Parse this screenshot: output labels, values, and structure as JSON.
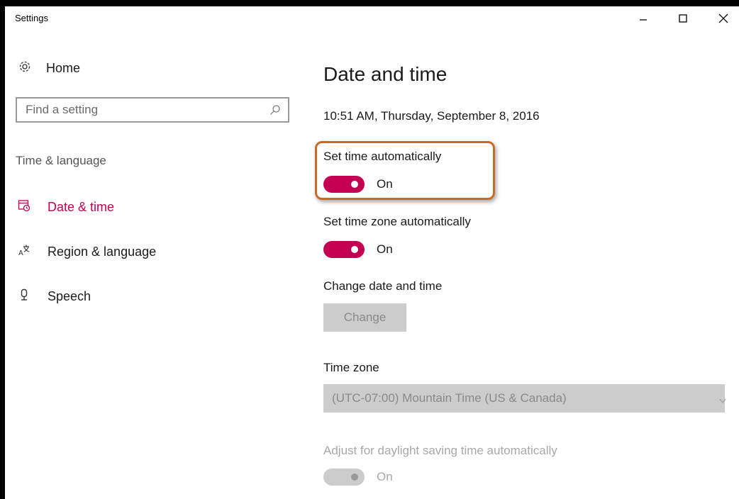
{
  "window": {
    "title": "Settings",
    "controls": [
      "minimize-icon",
      "maximize-icon",
      "close-icon"
    ]
  },
  "sidebar": {
    "home_label": "Home",
    "search_placeholder": "Find a setting",
    "section_label": "Time & language",
    "items": [
      {
        "label": "Date & time",
        "icon": "calendar-clock-icon",
        "active": true
      },
      {
        "label": "Region & language",
        "icon": "region-language-icon",
        "active": false
      },
      {
        "label": "Speech",
        "icon": "microphone-icon",
        "active": false
      }
    ]
  },
  "main": {
    "title": "Date and time",
    "current_time": "10:51 AM, Thursday, September 8, 2016",
    "set_time_auto": {
      "label": "Set time automatically",
      "state": "On",
      "enabled": true
    },
    "set_tz_auto": {
      "label": "Set time zone automatically",
      "state": "On",
      "enabled": true
    },
    "change_date_time": {
      "label": "Change date and time",
      "button": "Change",
      "enabled": false
    },
    "time_zone": {
      "label": "Time zone",
      "value": "(UTC-07:00) Mountain Time (US & Canada)",
      "enabled": false
    },
    "dst": {
      "label": "Adjust for daylight saving time automatically",
      "state": "On",
      "enabled": false
    }
  },
  "colors": {
    "accent": "#c30052",
    "highlight": "#c86a2a",
    "disabled_fill": "#cccccc",
    "disabled_text": "#a8a8a8"
  }
}
